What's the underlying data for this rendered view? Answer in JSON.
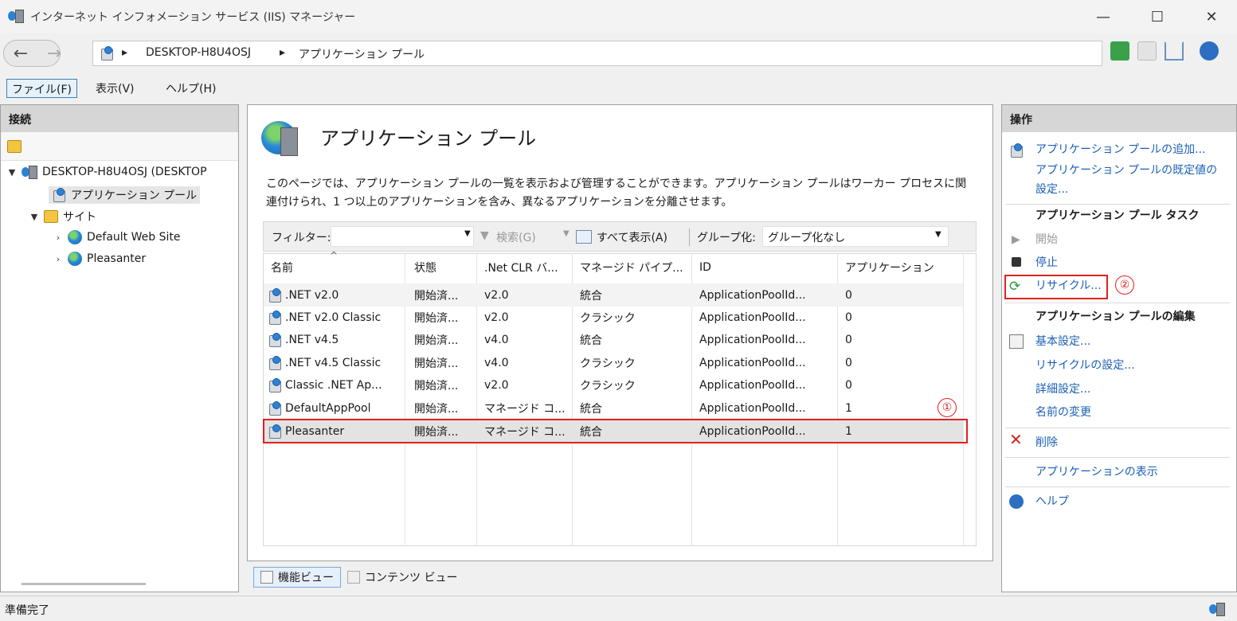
{
  "window": {
    "title": "インターネット インフォメーション サービス (IIS) マネージャー",
    "minimize": "—",
    "maximize": "☐",
    "close": "✕"
  },
  "address": {
    "back": "←",
    "forward": "→",
    "crumbs": [
      "DESKTOP-H8U4OSJ",
      "アプリケーション プール"
    ],
    "arrow": "▸"
  },
  "menu": {
    "file": "ファイル(F)",
    "view": "表示(V)",
    "help": "ヘルプ(H)"
  },
  "connections": {
    "header": "接続",
    "tree": {
      "server": "DESKTOP-H8U4OSJ (DESKTOP",
      "app_pools": "アプリケーション プール",
      "sites": "サイト",
      "site1": "Default Web Site",
      "site2": "Pleasanter"
    }
  },
  "content": {
    "title": "アプリケーション プール",
    "description_line1": "このページでは、アプリケーション プールの一覧を表示および管理することができます。アプリケーション プールはワーカー プロセスに関",
    "description_line2": "連付けられ、1 つ以上のアプリケーションを含み、異なるアプリケーションを分離させます。",
    "filter_label": "フィルター:",
    "search": "検索(G)",
    "show_all": "すべて表示(A)",
    "group_label": "グループ化:",
    "group_value": "グループ化なし",
    "columns": [
      "名前",
      "状態",
      ".Net CLR バ...",
      "マネージド パイプ...",
      "ID",
      "アプリケーション"
    ],
    "rows": [
      {
        "name": ".NET v2.0",
        "state": "開始済...",
        "clr": "v2.0",
        "pipeline": "統合",
        "id": "ApplicationPoolId...",
        "apps": "0"
      },
      {
        "name": ".NET v2.0 Classic",
        "state": "開始済...",
        "clr": "v2.0",
        "pipeline": "クラシック",
        "id": "ApplicationPoolId...",
        "apps": "0"
      },
      {
        "name": ".NET v4.5",
        "state": "開始済...",
        "clr": "v4.0",
        "pipeline": "統合",
        "id": "ApplicationPoolId...",
        "apps": "0"
      },
      {
        "name": ".NET v4.5 Classic",
        "state": "開始済...",
        "clr": "v4.0",
        "pipeline": "クラシック",
        "id": "ApplicationPoolId...",
        "apps": "0"
      },
      {
        "name": "Classic .NET Ap...",
        "state": "開始済...",
        "clr": "v2.0",
        "pipeline": "クラシック",
        "id": "ApplicationPoolId...",
        "apps": "0"
      },
      {
        "name": "DefaultAppPool",
        "state": "開始済...",
        "clr": "マネージド コ...",
        "pipeline": "統合",
        "id": "ApplicationPoolId...",
        "apps": "1"
      },
      {
        "name": "Pleasanter",
        "state": "開始済...",
        "clr": "マネージド コ...",
        "pipeline": "統合",
        "id": "ApplicationPoolId...",
        "apps": "1"
      }
    ],
    "annotation_1": "①",
    "features_view": "機能ビュー",
    "content_view": "コンテンツ ビュー"
  },
  "actions": {
    "header": "操作",
    "add_pool": "アプリケーション プールの追加...",
    "defaults_1": "アプリケーション プールの既定値の",
    "defaults_2": "設定...",
    "tasks_header": "アプリケーション プール タスク",
    "start": "開始",
    "stop": "停止",
    "recycle": "リサイクル...",
    "annotation_2": "②",
    "edit_header": "アプリケーション プールの編集",
    "basic": "基本設定...",
    "recycle_settings": "リサイクルの設定...",
    "advanced": "詳細設定...",
    "rename": "名前の変更",
    "delete": "削除",
    "view_apps": "アプリケーションの表示",
    "help": "ヘルプ"
  },
  "status": {
    "text": "準備完了"
  }
}
